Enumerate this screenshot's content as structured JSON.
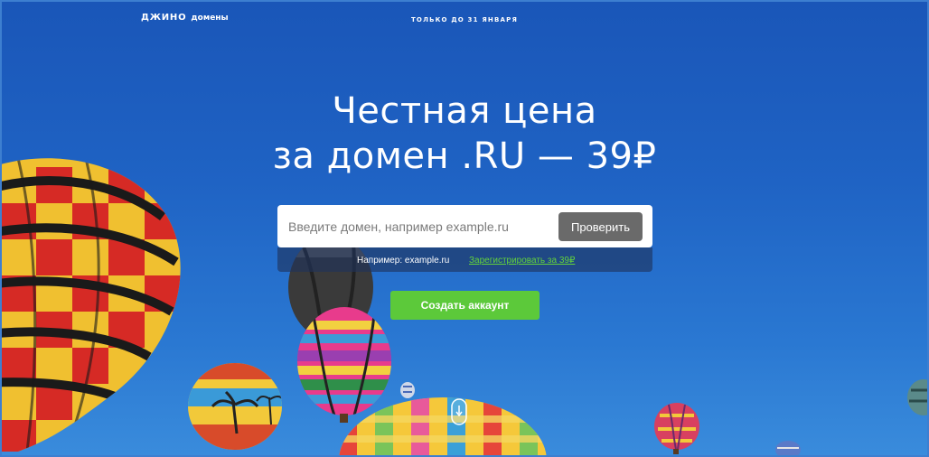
{
  "header": {
    "logo_main": "ДЖИНО",
    "logo_sub": "домены",
    "promo": "ТОЛЬКО ДО 31 ЯНВАРЯ"
  },
  "hero": {
    "headline_line1": "Честная цена",
    "headline_line2": "за домен .RU — 39₽"
  },
  "search": {
    "placeholder": "Введите домен, например example.ru",
    "value": "",
    "button_label": "Проверить"
  },
  "hint": {
    "example_text": "Например: example.ru",
    "register_link": "Зарегистрировать за 39₽"
  },
  "cta": {
    "create_account_label": "Создать аккаунт"
  },
  "icons": {
    "scroll": "scroll-down-icon"
  },
  "colors": {
    "background_top": "#1a56b8",
    "background_bottom": "#3a8cdc",
    "accent_green": "#5cc93a",
    "link_green": "#62d33c",
    "button_gray": "#6a6a6a"
  }
}
